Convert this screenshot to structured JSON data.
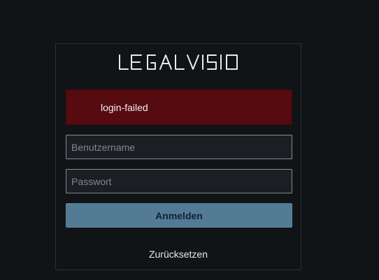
{
  "brand": {
    "logo_text": "LEGALVISIO"
  },
  "alert": {
    "message": "login-failed"
  },
  "form": {
    "username_placeholder": "Benutzername",
    "password_placeholder": "Passwort",
    "submit_label": "Anmelden",
    "reset_label": "Zurücksetzen"
  },
  "colors": {
    "page_background": "#111417",
    "alert_background": "#560b11",
    "submit_background": "#537b95"
  }
}
